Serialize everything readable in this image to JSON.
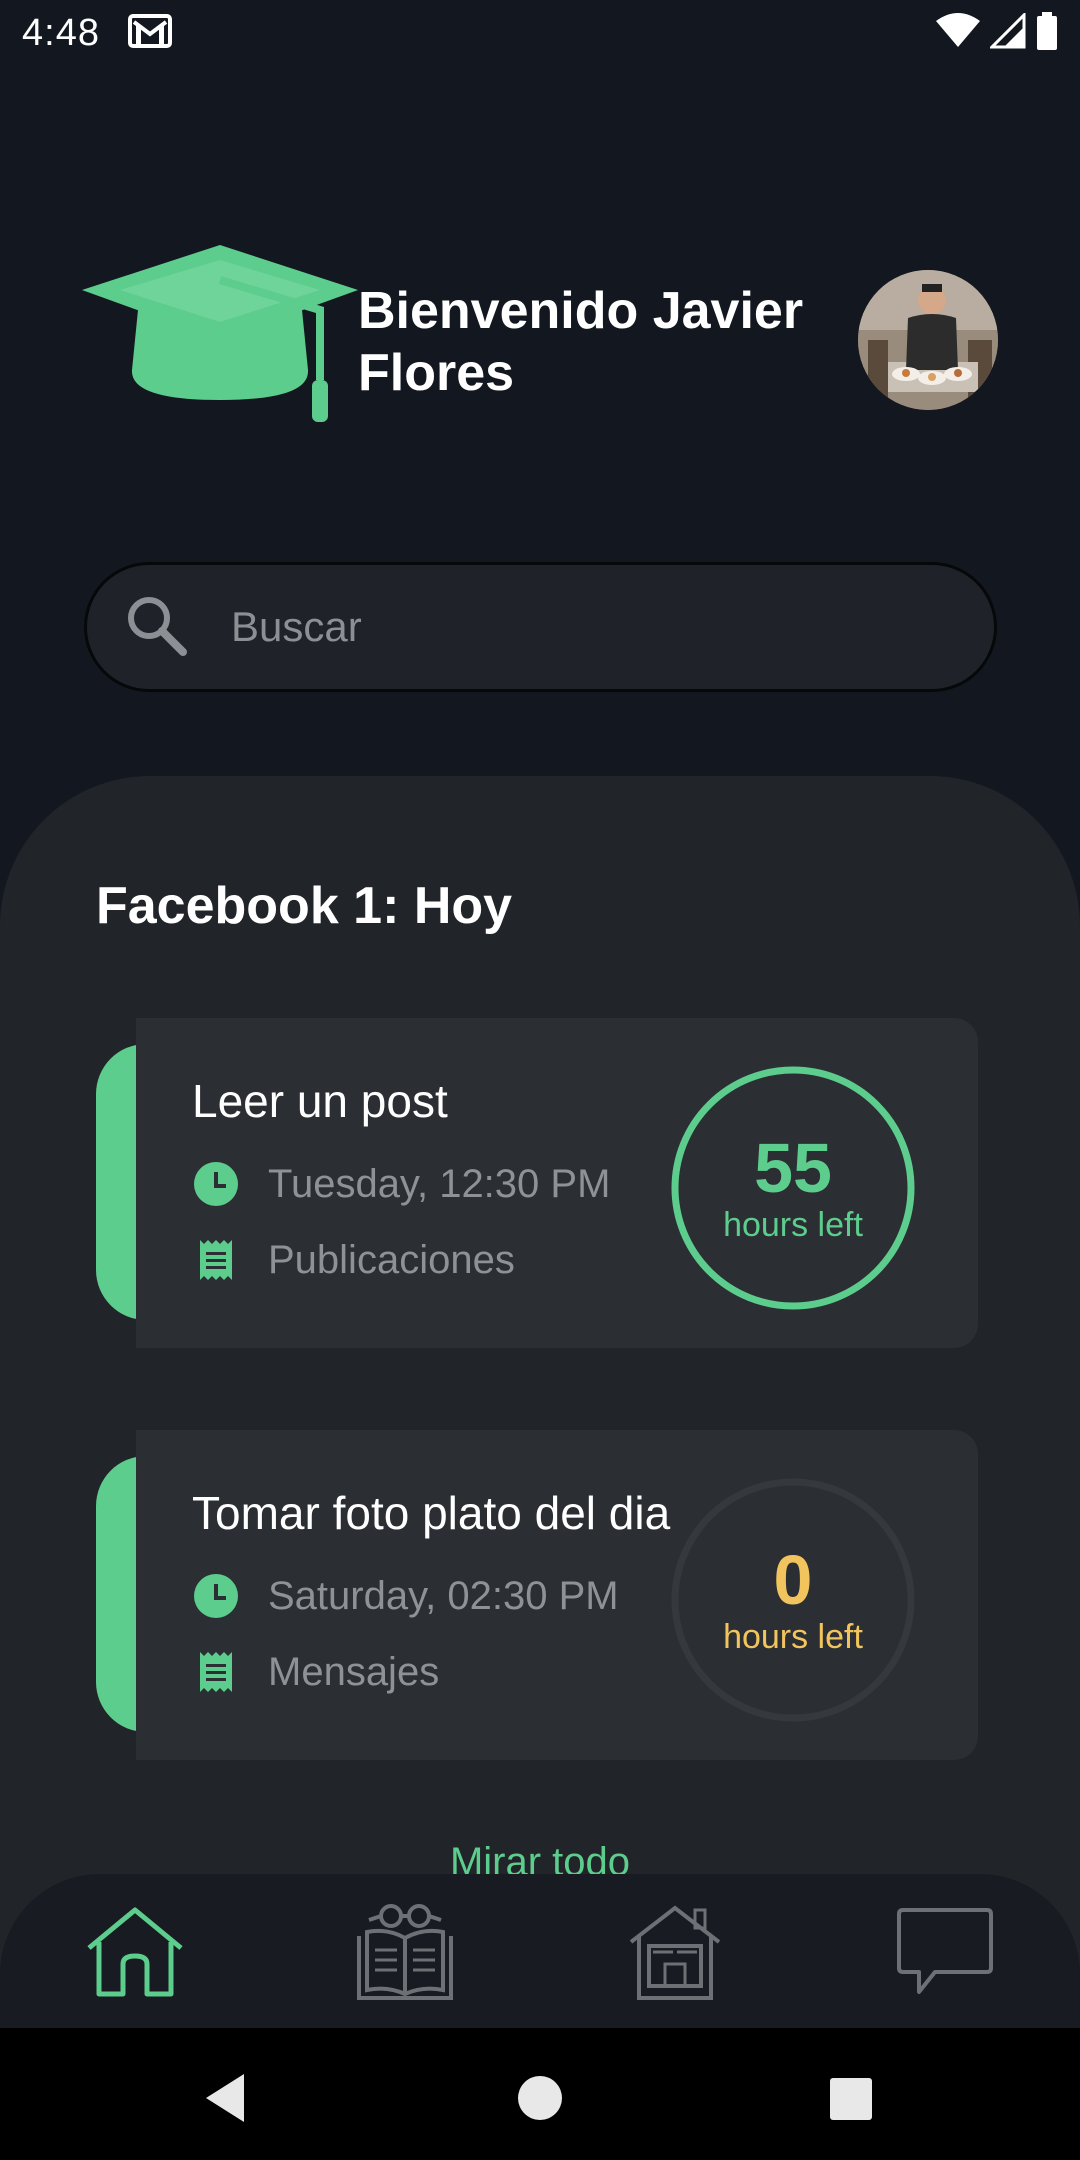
{
  "status_bar": {
    "time": "4:48",
    "icons": [
      "gmail-icon",
      "wifi-icon",
      "signal-icon",
      "battery-icon"
    ]
  },
  "header": {
    "welcome_text": "Bienvenido Javier Flores",
    "logo_icon": "graduation-cap-icon",
    "accent_color": "#5dcd8d"
  },
  "search": {
    "placeholder": "Buscar"
  },
  "section": {
    "title": "Facebook 1: Hoy"
  },
  "tasks": [
    {
      "title": "Leer un post",
      "datetime": "Tuesday, 12:30 PM",
      "category": "Publicaciones",
      "hours_value": "55",
      "hours_label": "hours left",
      "ring_color": "#5dcd8d"
    },
    {
      "title": "Tomar foto plato del dia",
      "datetime": "Saturday, 02:30 PM",
      "category": "Mensajes",
      "hours_value": "0",
      "hours_label": "hours left",
      "ring_color": "#f2c45e"
    }
  ],
  "see_all_label": "Mirar todo",
  "bottom_nav": [
    "home-icon",
    "reading-icon",
    "workspace-icon",
    "chat-icon"
  ],
  "colors": {
    "background": "#131820",
    "panel": "#212428",
    "card": "#2b2e33",
    "accent_green": "#5dcd8d",
    "accent_yellow": "#f2c45e"
  }
}
